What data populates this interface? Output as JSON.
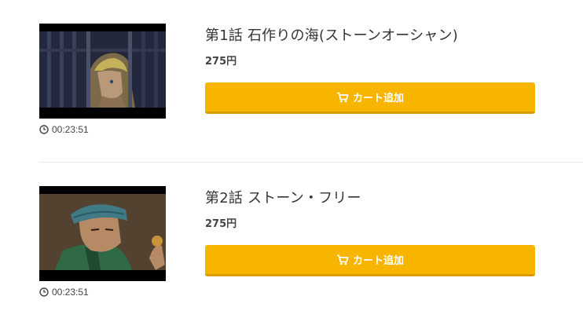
{
  "episodes": [
    {
      "title": "第1話 石作りの海(ストーンオーシャン)",
      "price": "275円",
      "cart_label": "カート追加",
      "duration": "00:23:51",
      "thumbnail": "prison-bars-character-thumbnail"
    },
    {
      "title": "第2話 ストーン・フリー",
      "price": "275円",
      "cart_label": "カート追加",
      "duration": "00:23:51",
      "thumbnail": "character-with-cap-thumbnail"
    }
  ],
  "icons": {
    "cart": "cart-icon",
    "clock": "clock-icon"
  },
  "colors": {
    "button": "#f7b500",
    "button_shadow": "#d89d00",
    "divider": "#e6e6e6"
  }
}
